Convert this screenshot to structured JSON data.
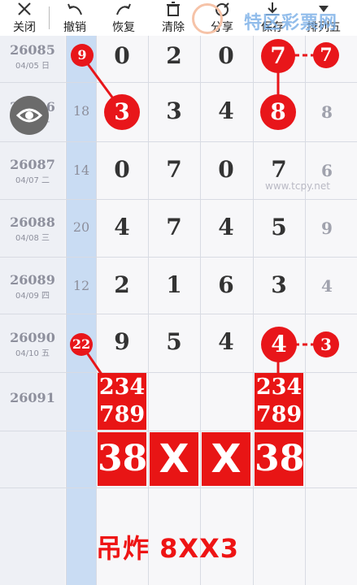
{
  "toolbar": {
    "close_label": "关闭",
    "undo_label": "撤销",
    "redo_label": "恢复",
    "clear_label": "清除",
    "share_label": "分享",
    "save_label": "保存",
    "more_label": "排列五"
  },
  "watermark": {
    "brand": "特区彩票网",
    "url": "www.tcpy.net"
  },
  "rows": [
    {
      "issue": "26085",
      "date": "04/05 日",
      "sum": "",
      "d1": "9",
      "d2": "0",
      "d3": "2",
      "d4": "0",
      "d5": "7",
      "ext": "7"
    },
    {
      "issue": "26086",
      "date": "04/06 一",
      "sum": "18",
      "d1": "3",
      "d2": "3",
      "d3": "4",
      "d4": "8",
      "d5": "",
      "ext": "8"
    },
    {
      "issue": "26087",
      "date": "04/07 二",
      "sum": "14",
      "d1": "0",
      "d2": "7",
      "d3": "0",
      "d4": "7",
      "d5": "",
      "ext": "6"
    },
    {
      "issue": "26088",
      "date": "04/08 三",
      "sum": "20",
      "d1": "4",
      "d2": "7",
      "d3": "4",
      "d4": "5",
      "d5": "",
      "ext": "9"
    },
    {
      "issue": "26089",
      "date": "04/09 四",
      "sum": "12",
      "d1": "2",
      "d2": "1",
      "d3": "6",
      "d4": "3",
      "d5": "",
      "ext": "4"
    },
    {
      "issue": "26090",
      "date": "04/10 五",
      "sum": "",
      "d1": "9",
      "d2": "5",
      "d3": "4",
      "d4": "4",
      "d5": "",
      "ext": "3"
    },
    {
      "issue": "26091",
      "date": ""
    }
  ],
  "balls": {
    "r85_left": "9",
    "r85_right": "7",
    "r85_ext": "7",
    "r86_left": "3",
    "r86_right": "8",
    "r90_sum": "22",
    "r90_right": "4",
    "r90_ext": "3"
  },
  "prediction": {
    "col1_top": "234",
    "col1_bottom": "789",
    "col4_top": "234",
    "col4_bottom": "789",
    "big1": "38",
    "big2": "X",
    "big3": "X",
    "big4": "38"
  },
  "caption": "吊炸 8XX3",
  "colors": {
    "accent_red": "#e81515",
    "sum_column": "#c9dcf3",
    "issue_column": "#eef0f5"
  }
}
